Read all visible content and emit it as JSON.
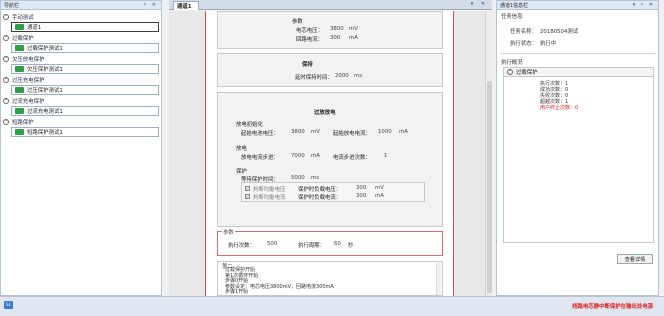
{
  "nav": {
    "title": "导航栏",
    "title_buttons": "♯ ✕",
    "groups": [
      {
        "label": "手动测试",
        "items": [
          {
            "label": "通道1",
            "selected": true
          }
        ]
      },
      {
        "label": "过载保护",
        "items": [
          {
            "label": "过载保护测试1"
          }
        ]
      },
      {
        "label": "欠压放电保护",
        "items": [
          {
            "label": "欠压保护测试1"
          }
        ]
      },
      {
        "label": "过压充电保护",
        "items": [
          {
            "label": "过压保护测试1"
          }
        ]
      },
      {
        "label": "过流充电保护",
        "items": [
          {
            "label": "过流充电测试1"
          }
        ]
      },
      {
        "label": "短路保护",
        "items": [
          {
            "label": "短路保护测试1"
          }
        ]
      }
    ]
  },
  "document": {
    "tab": "通道1",
    "tab_controls": "▾ ✕",
    "top_params": {
      "title": "参数",
      "voltage_label": "电芯电压：",
      "voltage_value": "3800",
      "voltage_unit": "mV",
      "return_current_label": "回路电流：",
      "return_current_value": "300",
      "return_current_unit": "mA"
    },
    "hold": {
      "title": "保持",
      "duration_label": "延时保持时间：",
      "duration_value": "2000",
      "duration_unit": "ms"
    },
    "overdischarge": {
      "title": "过放放电",
      "init_title": "放电初始化",
      "start_cell_voltage_label": "起始电池电压：",
      "start_cell_voltage_value": "3800",
      "start_cell_voltage_unit": "mV",
      "start_current_label": "起始放电电流：",
      "start_current_value": "1000",
      "start_current_unit": "mA",
      "discharge_title": "放电",
      "step_label": "放电电流步进：",
      "step_value": "7000",
      "step_unit": "mA",
      "count_label": "电流步进次数：",
      "count_value": "1",
      "protect_title": "保护",
      "wait_label": "等待保护时间：",
      "wait_value": "5000",
      "wait_unit": "ms",
      "check_voltage_label": "判断均衡电压",
      "protect_voltage_label": "保护时负载电压：",
      "protect_voltage_value": "300",
      "protect_voltage_unit": "mV",
      "check_current_label": "判断均衡电流",
      "protect_current_label": "保护时负载电流：",
      "protect_current_value": "300",
      "protect_current_unit": "mA"
    },
    "params": {
      "legend": "参数",
      "exec_count_label": "执行次数：",
      "exec_count_value": "500",
      "exec_period_label": "执行周期：",
      "exec_period_value": "60",
      "exec_period_unit": "秒"
    },
    "log": {
      "legend": "第二",
      "lines": [
        "过载保护开始",
        "第1次循环开始",
        "步骤0开始",
        "参数设定：电芯电压3800mV，回路电流300mA",
        "步骤1开始"
      ]
    }
  },
  "right": {
    "title": "通道1信息栏",
    "title_buttons": "▾ ♯ ✕",
    "task_section": "任务信息",
    "task_name_label": "任务名称：",
    "task_name_value": "20180504测试",
    "status_label": "执行状态：",
    "status_value": "执行中",
    "overview_section": "执行概况",
    "case_name": "过载保护",
    "stats": [
      {
        "text": "执行次数：1",
        "red": false
      },
      {
        "text": "成功次数：0",
        "red": false
      },
      {
        "text": "失败次数：0",
        "red": false
      },
      {
        "text": "超越次数：1",
        "red": false
      },
      {
        "text": "用户终止次数：0",
        "red": true
      }
    ],
    "detail_button": "查看详情"
  },
  "statusbar": {
    "logo": "SL",
    "alert": "线路电芯静中断保护在输出处电源"
  }
}
